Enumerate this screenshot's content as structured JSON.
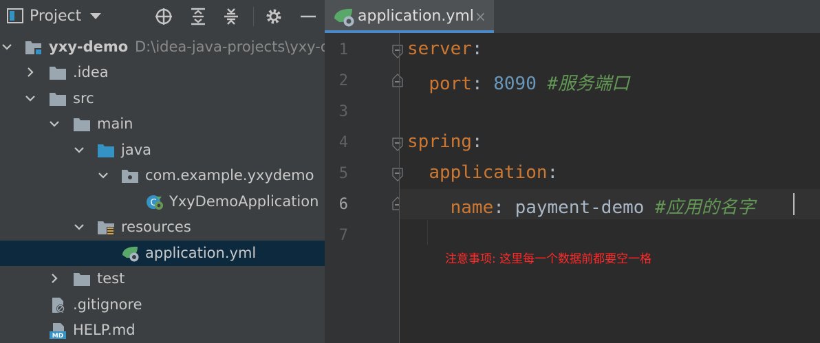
{
  "project_panel": {
    "title": "Project",
    "header_icons": [
      "locate-icon",
      "expand-all-icon",
      "collapse-all-icon",
      "gear-icon",
      "hide-icon"
    ],
    "tree": [
      {
        "label": "yxy-demo",
        "path": "D:\\idea-java-projects\\yxy-d",
        "icon": "module-icon",
        "expanded": true,
        "depth": 0
      },
      {
        "label": ".idea",
        "icon": "folder-icon",
        "expanded": false,
        "depth": 1
      },
      {
        "label": "src",
        "icon": "folder-icon",
        "expanded": true,
        "depth": 1
      },
      {
        "label": "main",
        "icon": "folder-icon",
        "expanded": true,
        "depth": 2
      },
      {
        "label": "java",
        "icon": "source-folder-icon",
        "expanded": true,
        "depth": 3
      },
      {
        "label": "com.example.yxydemo",
        "icon": "package-icon",
        "expanded": true,
        "depth": 4
      },
      {
        "label": "YxyDemoApplication",
        "icon": "spring-boot-class-icon",
        "depth": 5
      },
      {
        "label": "resources",
        "icon": "resources-folder-icon",
        "expanded": true,
        "depth": 3
      },
      {
        "label": "application.yml",
        "icon": "spring-yaml-icon",
        "depth": 5,
        "selected": true
      },
      {
        "label": "test",
        "icon": "folder-icon",
        "expanded": false,
        "depth": 2
      },
      {
        "label": ".gitignore",
        "icon": "gitignore-file-icon",
        "depth": 1
      },
      {
        "label": "HELP.md",
        "icon": "markdown-file-icon",
        "depth": 1
      }
    ]
  },
  "editor": {
    "tab": {
      "label": "application.yml",
      "close_glyph": "×",
      "icon": "spring-yaml-icon"
    },
    "line_numbers": [
      "1",
      "2",
      "3",
      "4",
      "5",
      "6",
      "7"
    ],
    "active_line": "6",
    "lines": [
      {
        "key": "server",
        "colon": ":"
      },
      {
        "indent": "  ",
        "key": "port",
        "colon": ":",
        "value": "8090",
        "comment": "#服务端口"
      },
      {},
      {
        "key": "spring",
        "colon": ":"
      },
      {
        "indent": "  ",
        "key": "application",
        "colon": ":"
      },
      {
        "indent": "    ",
        "key": "name",
        "colon": ":",
        "value": "payment-demo",
        "comment": "#应用的名字"
      },
      {}
    ],
    "annotation": "注意事项: 这里每一个数据前都要空一格"
  },
  "colors": {
    "panel_bg": "#3c3f41",
    "editor_bg": "#2b2b2b",
    "selection_bg": "#0d293e",
    "keyword": "#cc7832",
    "number": "#6897bb",
    "comment": "#629755",
    "text": "#a9b7c6",
    "annotation": "#ff2a2a"
  }
}
